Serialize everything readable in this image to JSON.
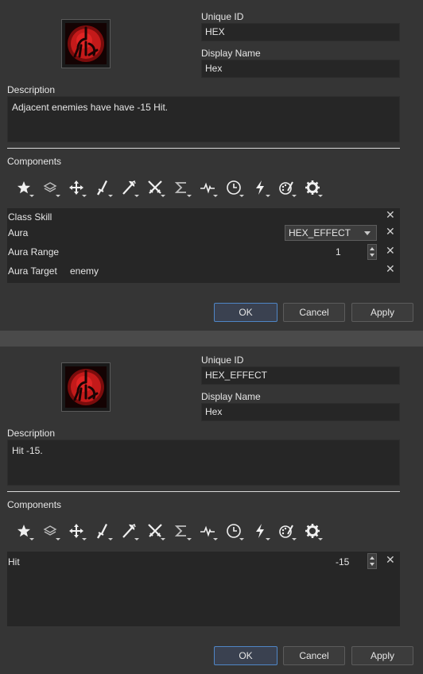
{
  "dialogs": [
    {
      "icon": "hex-skill-icon",
      "unique_id_label": "Unique ID",
      "unique_id": "HEX",
      "display_name_label": "Display Name",
      "display_name": "Hex",
      "description_label": "Description",
      "description": "Adjacent enemies have have -15 Hit.",
      "components_label": "Components",
      "components": {
        "class_skill": {
          "label": "Class Skill"
        },
        "aura": {
          "label": "Aura",
          "value": "HEX_EFFECT"
        },
        "aura_range": {
          "label": "Aura Range",
          "value": "1"
        },
        "aura_target": {
          "label": "Aura Target",
          "value": "enemy"
        }
      },
      "buttons": {
        "ok": "OK",
        "cancel": "Cancel",
        "apply": "Apply"
      }
    },
    {
      "icon": "hex-skill-icon",
      "unique_id_label": "Unique ID",
      "unique_id": "HEX_EFFECT",
      "display_name_label": "Display Name",
      "display_name": "Hex",
      "description_label": "Description",
      "description": "Hit -15.",
      "components_label": "Components",
      "components": {
        "hit": {
          "label": "Hit",
          "value": "-15"
        }
      },
      "buttons": {
        "ok": "OK",
        "cancel": "Cancel",
        "apply": "Apply"
      }
    }
  ],
  "toolbar_icons": [
    "star-icon",
    "layers-icon",
    "move-icon",
    "sword-icon",
    "axe-icon",
    "crossed-swords-icon",
    "sigma-icon",
    "pulse-icon",
    "clock-icon",
    "lightning-icon",
    "palette-icon",
    "gear-icon"
  ],
  "colors": {
    "panel_bg": "#353535",
    "field_bg": "#262626",
    "icon_red": "#c41a1a",
    "primary_border": "#4f86c6"
  }
}
